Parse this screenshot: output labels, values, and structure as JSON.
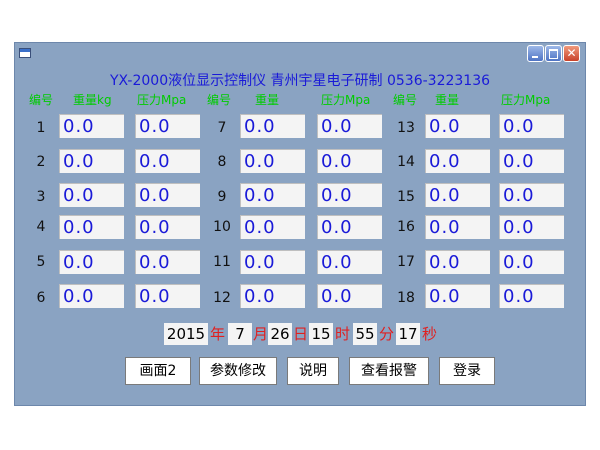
{
  "window": {
    "title": "YX-2000液位显示控制仪 青州宇星电子研制 0536-3223136"
  },
  "columns": {
    "group1": {
      "num": "编号",
      "weight": "重量kg",
      "pressure": "压力Mpa"
    },
    "group2": {
      "num": "编号",
      "weight": "重量",
      "pressure": "压力Mpa"
    },
    "group3": {
      "num": "编号",
      "weight": "重量",
      "pressure": "压力Mpa"
    }
  },
  "channels": [
    {
      "num": "1",
      "weight": "0.0",
      "pressure": "0.0"
    },
    {
      "num": "2",
      "weight": "0.0",
      "pressure": "0.0"
    },
    {
      "num": "3",
      "weight": "0.0",
      "pressure": "0.0"
    },
    {
      "num": "4",
      "weight": "0.0",
      "pressure": "0.0"
    },
    {
      "num": "5",
      "weight": "0.0",
      "pressure": "0.0"
    },
    {
      "num": "6",
      "weight": "0.0",
      "pressure": "0.0"
    },
    {
      "num": "7",
      "weight": "0.0",
      "pressure": "0.0"
    },
    {
      "num": "8",
      "weight": "0.0",
      "pressure": "0.0"
    },
    {
      "num": "9",
      "weight": "0.0",
      "pressure": "0.0"
    },
    {
      "num": "10",
      "weight": "0.0",
      "pressure": "0.0"
    },
    {
      "num": "11",
      "weight": "0.0",
      "pressure": "0.0"
    },
    {
      "num": "12",
      "weight": "0.0",
      "pressure": "0.0"
    },
    {
      "num": "13",
      "weight": "0.0",
      "pressure": "0.0"
    },
    {
      "num": "14",
      "weight": "0.0",
      "pressure": "0.0"
    },
    {
      "num": "15",
      "weight": "0.0",
      "pressure": "0.0"
    },
    {
      "num": "16",
      "weight": "0.0",
      "pressure": "0.0"
    },
    {
      "num": "17",
      "weight": "0.0",
      "pressure": "0.0"
    },
    {
      "num": "18",
      "weight": "0.0",
      "pressure": "0.0"
    }
  ],
  "datetime": {
    "year": "2015",
    "year_unit": "年",
    "month": "7",
    "month_unit": "月",
    "day": "26",
    "day_unit": "日",
    "hour": "15",
    "hour_unit": "时",
    "minute": "55",
    "minute_unit": "分",
    "second": "17",
    "second_unit": "秒"
  },
  "buttons": {
    "screen2": "画面2",
    "params": "参数修改",
    "help": "说明",
    "alarms": "查看报警",
    "login": "登录"
  },
  "colors": {
    "window_bg": "#8aa3c2",
    "title_text": "#1a1ad8",
    "column_header": "#00cc00",
    "value_text": "#1a1ad8",
    "date_unit": "#e02020"
  },
  "icons": [
    "app-icon",
    "minimize-icon",
    "maximize-icon",
    "close-icon"
  ]
}
